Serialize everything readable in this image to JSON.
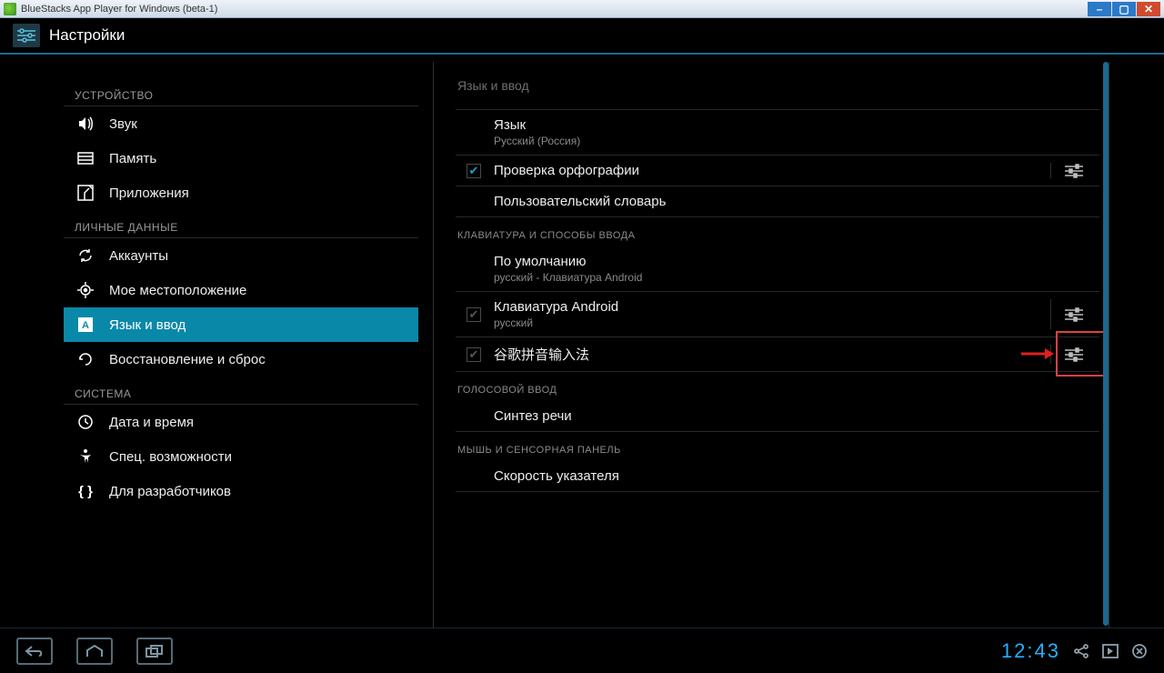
{
  "window": {
    "title": "BlueStacks App Player for Windows (beta-1)"
  },
  "header": {
    "title": "Настройки"
  },
  "sidebar": {
    "sections": [
      {
        "label": "УСТРОЙСТВО",
        "items": [
          {
            "icon": "sound",
            "label": "Звук"
          },
          {
            "icon": "memory",
            "label": "Память"
          },
          {
            "icon": "apps",
            "label": "Приложения"
          }
        ]
      },
      {
        "label": "ЛИЧНЫЕ ДАННЫЕ",
        "items": [
          {
            "icon": "sync",
            "label": "Аккаунты"
          },
          {
            "icon": "location",
            "label": "Мое местоположение"
          },
          {
            "icon": "language",
            "label": "Язык и ввод",
            "selected": true
          },
          {
            "icon": "reset",
            "label": "Восстановление и сброс"
          }
        ]
      },
      {
        "label": "СИСТЕМА",
        "items": [
          {
            "icon": "clock",
            "label": "Дата и время"
          },
          {
            "icon": "accessibility",
            "label": "Спец. возможности"
          },
          {
            "icon": "developer",
            "label": "Для разработчиков"
          }
        ]
      }
    ]
  },
  "panel": {
    "title": "Язык и ввод",
    "rows": [
      {
        "type": "item",
        "title": "Язык",
        "subtitle": "Русский (Россия)"
      },
      {
        "type": "check",
        "title": "Проверка орфографии",
        "checked": true,
        "action": true
      },
      {
        "type": "item",
        "title": "Пользовательский словарь"
      }
    ],
    "section2": {
      "label": "КЛАВИАТУРА И СПОСОБЫ ВВОДА",
      "rows": [
        {
          "type": "item",
          "title": "По умолчанию",
          "subtitle": "русский - Клавиатура Android"
        },
        {
          "type": "check",
          "title": "Клавиатура Android",
          "subtitle": "русский",
          "checked": true,
          "disabled": true,
          "action": true,
          "highlight": true
        },
        {
          "type": "check",
          "title": "谷歌拼音输入法",
          "checked": true,
          "disabled": true,
          "action": true
        }
      ]
    },
    "section3": {
      "label": "ГОЛОСОВОЙ ВВОД",
      "rows": [
        {
          "type": "item",
          "title": "Синтез речи"
        }
      ]
    },
    "section4": {
      "label": "МЫШЬ И СЕНСОРНАЯ ПАНЕЛЬ",
      "rows": [
        {
          "type": "item",
          "title": "Скорость указателя"
        }
      ]
    }
  },
  "bottombar": {
    "clock": "12:43"
  }
}
